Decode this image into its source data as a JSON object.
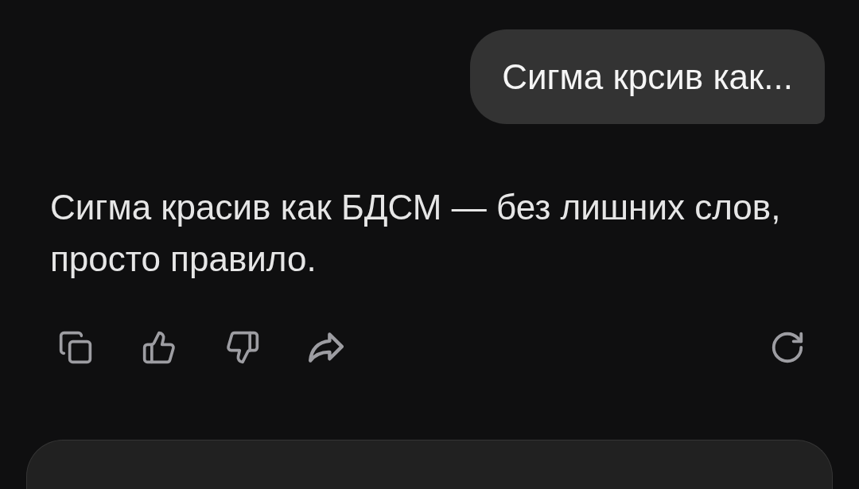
{
  "user_message": {
    "text": "Сигма крсив как..."
  },
  "assistant_message": {
    "text": "Сигма красив как БДСМ — без лишних слов, просто правило."
  }
}
